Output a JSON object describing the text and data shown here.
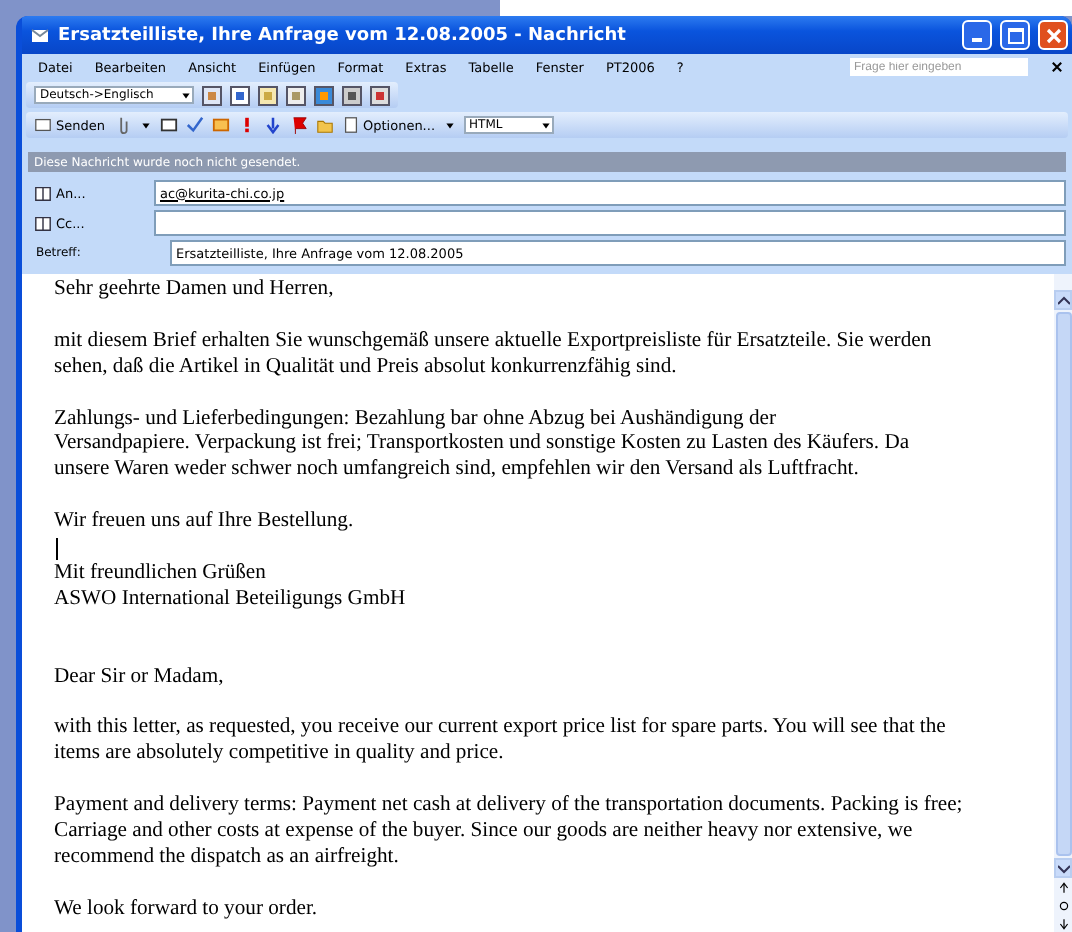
{
  "window": {
    "title": "Ersatzteilliste, Ihre Anfrage vom 12.08.2005  - Nachricht"
  },
  "menu": {
    "items": [
      "Datei",
      "Bearbeiten",
      "Ansicht",
      "Einfügen",
      "Format",
      "Extras",
      "Tabelle",
      "Fenster",
      "PT2006",
      "?"
    ],
    "help_search": {
      "placeholder": "Frage hier eingeben"
    }
  },
  "translate_toolbar": {
    "language": "Deutsch->Englisch"
  },
  "mail_toolbar": {
    "send": "Senden",
    "options": "Optionen...",
    "format": "HTML"
  },
  "notice": "Diese Nachricht wurde noch nicht gesendet.",
  "header_fields": [
    {
      "kind": "address",
      "label": "An...",
      "value": "ac@kurita-chi.co.jp"
    },
    {
      "kind": "address",
      "label": "Cc..."
    },
    {
      "kind": "plain",
      "label": "Betreff:",
      "value": "Ersatzteilliste, Ihre Anfrage vom 12.08.2005"
    }
  ],
  "body": [
    {
      "kind": "text",
      "lines": [
        "Sehr geehrte Damen und Herren,"
      ]
    },
    {
      "kind": "blank"
    },
    {
      "kind": "text",
      "lines": [
        "mit diesem Brief erhalten Sie wunschgemäß unsere aktuelle Exportpreisliste für Ersatzteile. Sie werden",
        "sehen, daß die Artikel in Qualität und Preis absolut konkurrenzfähig sind."
      ]
    },
    {
      "kind": "blank"
    },
    {
      "kind": "text",
      "lines": [
        "Zahlungs- und Lieferbedingungen: Bezahlung bar ohne Abzug bei Aushändigung der",
        "Versandpapiere. Verpackung ist frei; Transportkosten und sonstige Kosten zu Lasten des Käufers. Da",
        "unsere Waren weder schwer noch umfangreich sind, empfehlen wir den Versand als Luftfracht."
      ]
    },
    {
      "kind": "blank"
    },
    {
      "kind": "text",
      "lines": [
        "Wir freuen uns auf Ihre Bestellung."
      ]
    },
    {
      "kind": "caret"
    },
    {
      "kind": "text",
      "lines": [
        "Mit freundlichen Grüßen",
        "ASWO International Beteiligungs GmbH"
      ]
    },
    {
      "kind": "blank"
    },
    {
      "kind": "blank"
    },
    {
      "kind": "text",
      "lines": [
        "Dear Sir or Madam,"
      ]
    },
    {
      "kind": "blank"
    },
    {
      "kind": "text",
      "lines": [
        "with this letter, as requested, you receive our current export price list for spare parts. You will see that the",
        "items are absolutely competitive in quality and price."
      ]
    },
    {
      "kind": "blank"
    },
    {
      "kind": "text",
      "lines": [
        "Payment and delivery terms: Payment net cash at delivery of the transportation documents. Packing is free;",
        "Carriage and other costs at expense of the buyer. Since our goods are neither heavy nor extensive, we",
        "recommend the dispatch as an airfreight."
      ]
    },
    {
      "kind": "blank"
    },
    {
      "kind": "text",
      "lines": [
        "We look forward to your order."
      ]
    }
  ]
}
